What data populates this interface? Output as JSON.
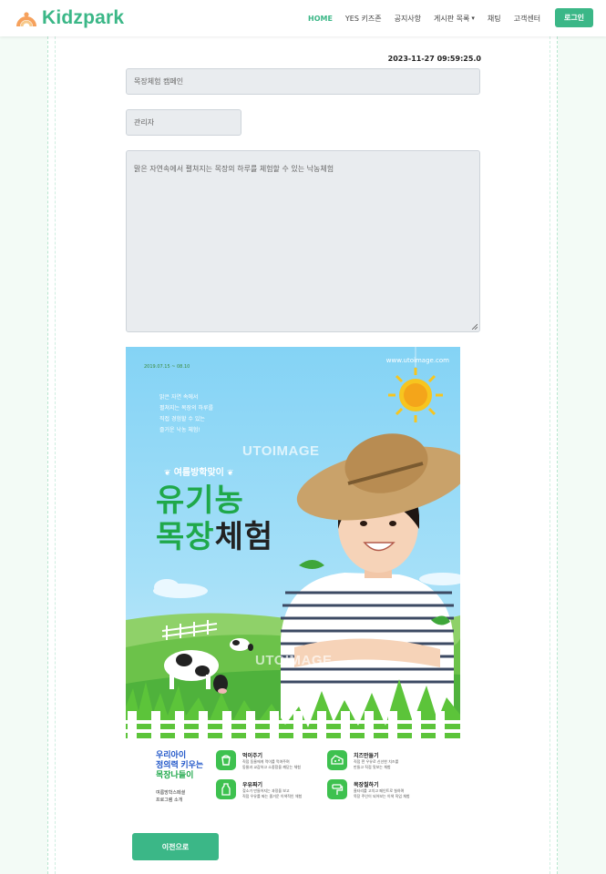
{
  "brand": {
    "name": "Kidzpark",
    "icon": "rainbow-arch-icon"
  },
  "nav": {
    "items": [
      {
        "label": "HOME",
        "active": true
      },
      {
        "label": "YES 키즈존",
        "active": false
      },
      {
        "label": "공지사항",
        "active": false
      },
      {
        "label": "게시판 목록",
        "active": false,
        "dropdown": true
      },
      {
        "label": "채팅",
        "active": false
      },
      {
        "label": "고객센터",
        "active": false
      }
    ],
    "login_label": "로그인"
  },
  "post": {
    "datetime": "2023-11-27 09:59:25.0",
    "title": "목장체험 캠페인",
    "author": "관리자",
    "body": "맑은 자연속에서 펼쳐지는 목장의 하루를 체험할 수 있는 낙농체험"
  },
  "poster": {
    "url": "www.utoimage.com",
    "date_range": "2019.07.15 ~ 08.10",
    "description": [
      "맑은 자연 속에서",
      "펼쳐지는 목장의 하루를",
      "직접 경험할 수 있는",
      "즐거운 낙농 체험!"
    ],
    "watermark": "UTOIMAGE",
    "subtitle": "여름방학맞이",
    "headline_line1": "유기농",
    "headline_line2_green": "목장",
    "headline_line2_black": "체험",
    "bottom_title": [
      "우리아이",
      "정의력 키우는",
      "목장나들이"
    ],
    "bottom_caption": [
      "여름방학스페셜",
      "프로그램 소개"
    ],
    "activities": [
      {
        "title": "먹이주기",
        "desc": [
          "직접 동물에게 먹이를 먹여주며",
          "동물과 교감하고 소중함을 깨닫는 체험"
        ],
        "icon": "bucket-icon"
      },
      {
        "title": "치즈만들기",
        "desc": [
          "직접 짠 우유로 신선한 치즈를",
          "만들고 직접 맛보는 체험"
        ],
        "icon": "cheese-icon"
      },
      {
        "title": "우유짜기",
        "desc": [
          "젖소가 만들어지는 과정을 보고",
          "직접 우유를 짜는 즐거운 이색적인 체험"
        ],
        "icon": "milk-bottle-icon"
      },
      {
        "title": "목장칠하기",
        "desc": [
          "울타리를 고치고 페인트로 칠하며",
          "목장 주인이 되어보는 이색 직업 체험"
        ],
        "icon": "paint-roller-icon"
      }
    ]
  },
  "back_label": "이전으로",
  "colors": {
    "accent": "#3bb787",
    "field_bg": "#e9ecef",
    "poster_sky": "#84d3f5",
    "poster_green": "#1fa84a"
  }
}
